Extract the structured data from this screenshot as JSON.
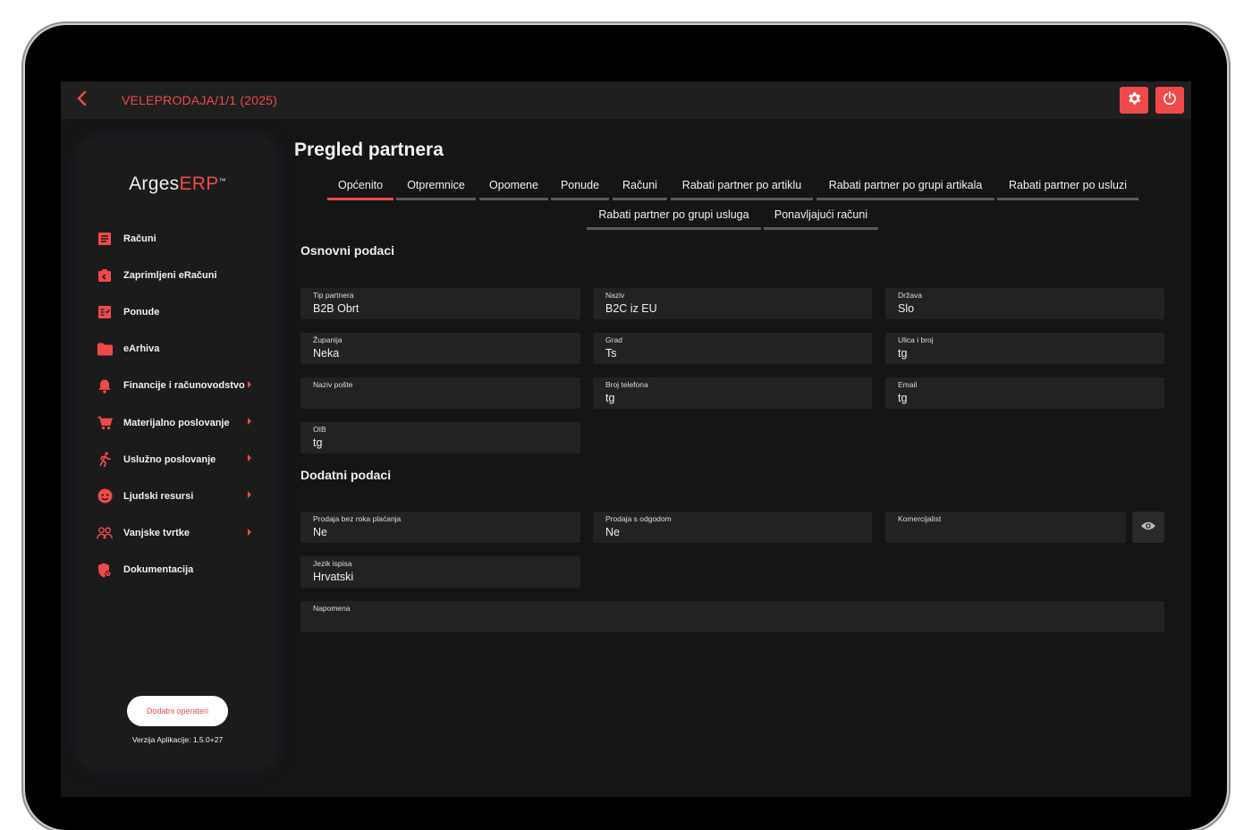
{
  "header": {
    "title": "VELEPRODAJA/1/1 (2025)",
    "back_icon": "chevron-left-icon",
    "settings_icon": "gear-icon",
    "power_icon": "power-icon",
    "accent_color": "#ef4a4a"
  },
  "sidebar": {
    "logo_main": "Arges",
    "logo_accent": "ERP",
    "logo_tm": "™",
    "items": [
      {
        "label": "Računi",
        "icon": "invoice-icon"
      },
      {
        "label": "Zaprimljeni eRačuni",
        "icon": "inbox-icon"
      },
      {
        "label": "Ponude",
        "icon": "offer-icon"
      },
      {
        "label": "eArhiva",
        "icon": "folder-icon"
      },
      {
        "label": "Financije i računovodstvo",
        "icon": "bell-icon"
      },
      {
        "label": "Materijalno poslovanje",
        "icon": "cart-icon"
      },
      {
        "label": "Uslužno poslovanje",
        "icon": "runner-icon"
      },
      {
        "label": "Ljudski resursi",
        "icon": "face-icon"
      },
      {
        "label": "Vanjske tvrtke",
        "icon": "people-icon"
      },
      {
        "label": "Dokumentacija",
        "icon": "shield-icon"
      }
    ],
    "operators_button": "Dodatni operateri",
    "version": "Verzija Aplikacije: 1.5.0+27"
  },
  "main": {
    "title": "Pregled partnera",
    "tabs": [
      "Općenito",
      "Otpremnice",
      "Opomene",
      "Ponude",
      "Računi",
      "Rabati partner po artiklu",
      "Rabati partner po grupi artikala",
      "Rabati partner po usluzi",
      "Rabati partner po grupi usluga",
      "Ponavljajući računi"
    ],
    "section1": "Osnovni podaci",
    "section2": "Dodatni podaci",
    "fields": {
      "tip_partnera": {
        "label": "Tip partnera",
        "value": "B2B Obrt"
      },
      "naziv": {
        "label": "Naziv",
        "value": "B2C iz EU"
      },
      "drzava": {
        "label": "Država",
        "value": "Slo"
      },
      "zupanija": {
        "label": "Županija",
        "value": "Neka"
      },
      "grad": {
        "label": "Grad",
        "value": "Ts"
      },
      "ulica": {
        "label": "Ulica i broj",
        "value": "tg"
      },
      "naziv_poste": {
        "label": "Naziv pošte",
        "value": ""
      },
      "telefon": {
        "label": "Broj telefona",
        "value": "tg"
      },
      "email": {
        "label": "Email",
        "value": "tg"
      },
      "oib": {
        "label": "OIB",
        "value": "tg"
      },
      "bez_roka": {
        "label": "Prodaja bez roka plaćanja",
        "value": "Ne"
      },
      "s_odgodom": {
        "label": "Prodaja s odgodom",
        "value": "Ne"
      },
      "komercijalist": {
        "label": "Komercijalist",
        "value": ""
      },
      "jezik": {
        "label": "Jezik ispisa",
        "value": "Hrvatski"
      },
      "napomena": {
        "label": "Napomena",
        "value": ""
      }
    },
    "eye_icon": "eye-icon"
  }
}
